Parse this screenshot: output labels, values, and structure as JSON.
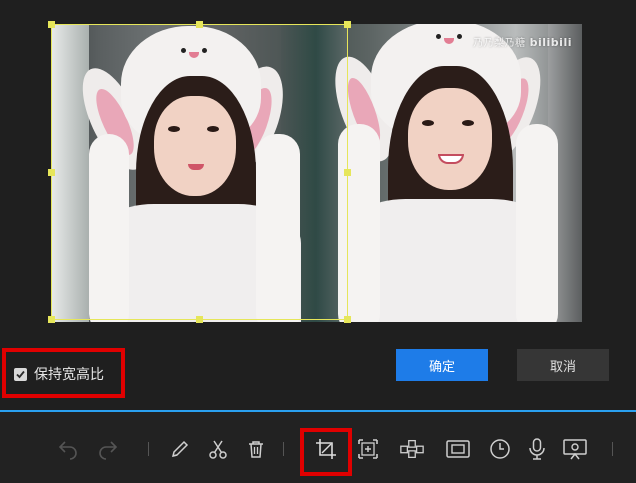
{
  "preview": {
    "watermark_text": "乃乃梨乃糖",
    "watermark_logo": "bilibili",
    "crop_color": "#e6e65a"
  },
  "options": {
    "keep_aspect_label": "保持宽高比",
    "keep_aspect_checked": true
  },
  "actions": {
    "confirm_label": "确定",
    "cancel_label": "取消"
  },
  "toolbar": {
    "tools": [
      {
        "icon": "undo-icon",
        "enabled": false
      },
      {
        "icon": "redo-icon",
        "enabled": false
      },
      {
        "icon": "pencil-icon",
        "enabled": true
      },
      {
        "icon": "scissors-icon",
        "enabled": true
      },
      {
        "icon": "trash-icon",
        "enabled": true
      },
      {
        "icon": "crop-icon",
        "enabled": true,
        "active": true
      },
      {
        "icon": "add-frame-icon",
        "enabled": true
      },
      {
        "icon": "mosaic-icon",
        "enabled": true
      },
      {
        "icon": "picture-in-picture-icon",
        "enabled": true
      },
      {
        "icon": "clock-icon",
        "enabled": true
      },
      {
        "icon": "microphone-icon",
        "enabled": true
      },
      {
        "icon": "screen-record-icon",
        "enabled": true
      }
    ]
  },
  "colors": {
    "accent": "#1e7ce8",
    "highlight": "#e00000",
    "divider": "#2aa0f0"
  }
}
